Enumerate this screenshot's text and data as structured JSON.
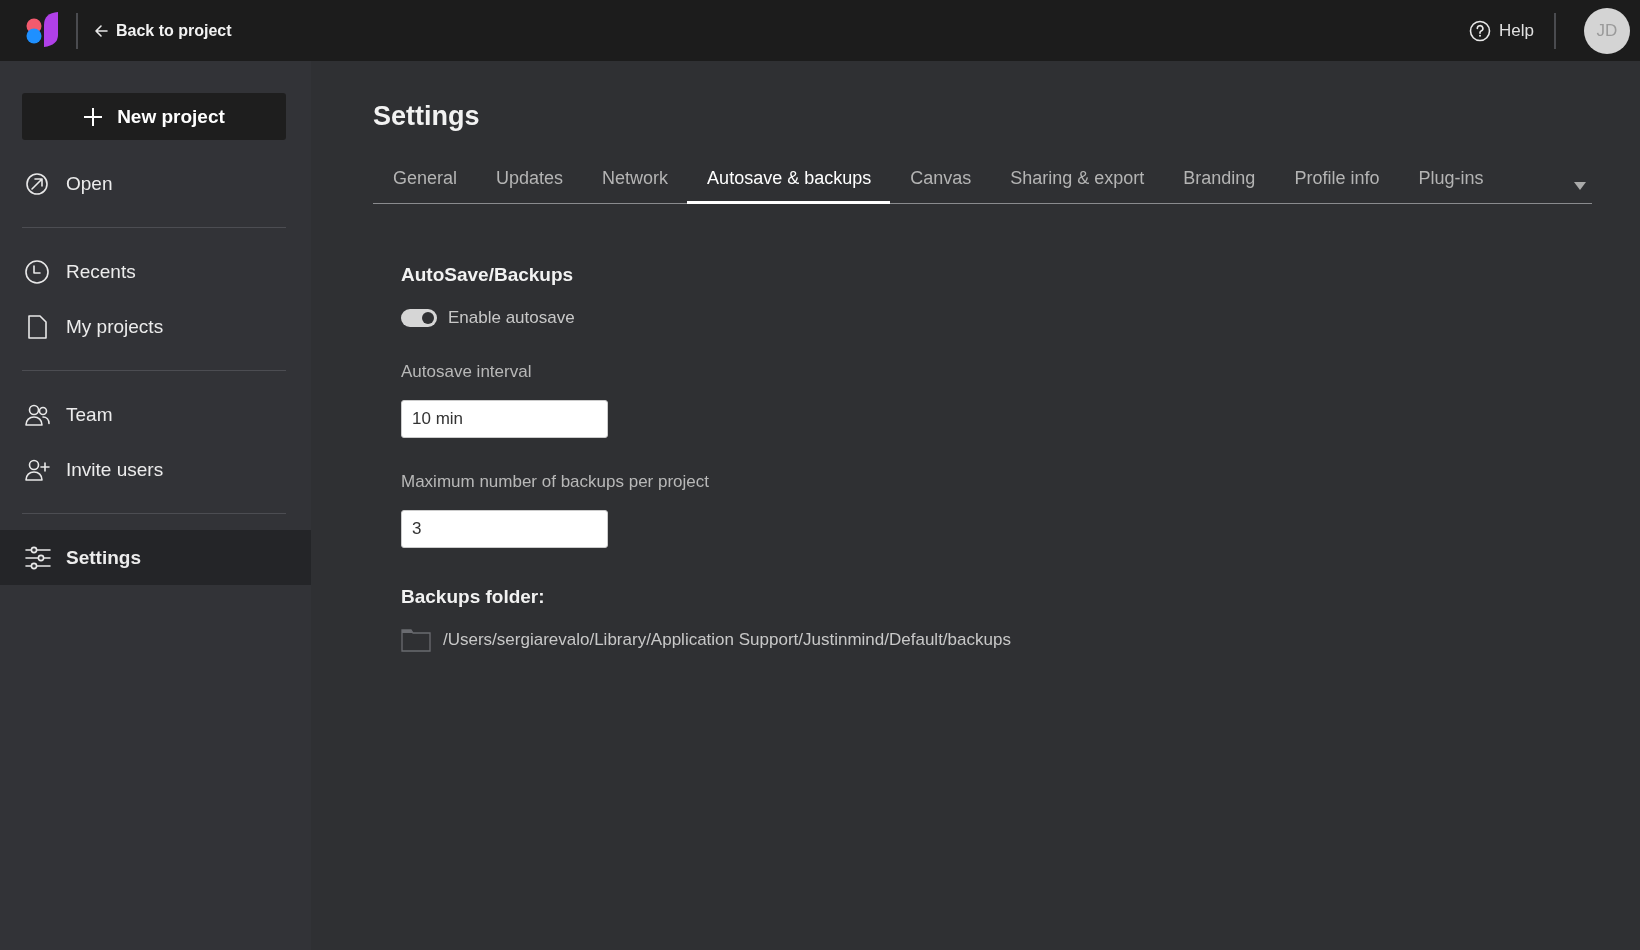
{
  "top_bar": {
    "back_link": "Back to project",
    "help": "Help",
    "avatar": "JD"
  },
  "sidebar": {
    "new_button": "New project",
    "groups": [
      [
        {
          "label": "Open",
          "selected": false
        }
      ],
      [
        {
          "label": "Recents",
          "selected": false
        },
        {
          "label": "My projects",
          "selected": false
        }
      ],
      [
        {
          "label": "Team",
          "selected": false
        },
        {
          "label": "Invite users",
          "selected": false
        }
      ],
      [
        {
          "label": "Settings",
          "selected": true
        }
      ]
    ]
  },
  "page": {
    "title": "Settings",
    "tabs": [
      {
        "label": "General",
        "selected": false
      },
      {
        "label": "Updates",
        "selected": false
      },
      {
        "label": "Network",
        "selected": false
      },
      {
        "label": "Autosave & backups",
        "selected": true
      },
      {
        "label": "Canvas",
        "selected": false
      },
      {
        "label": "Sharing & export",
        "selected": false
      },
      {
        "label": "Branding",
        "selected": false
      },
      {
        "label": "Profile info",
        "selected": false
      },
      {
        "label": "Plug-ins",
        "selected": false
      }
    ],
    "section": {
      "heading": "AutoSave/Backups",
      "toggle": {
        "label": "Enable autosave",
        "on": true
      },
      "fields": [
        {
          "label": "Autosave interval",
          "value": "10 min"
        },
        {
          "label": "Maximum number of backups per project",
          "value": "3"
        }
      ],
      "folder_heading": "Backups folder:",
      "folder_path": "/Users/sergiarevalo/Library/Application Support/Justinmind/Default/backups"
    }
  }
}
